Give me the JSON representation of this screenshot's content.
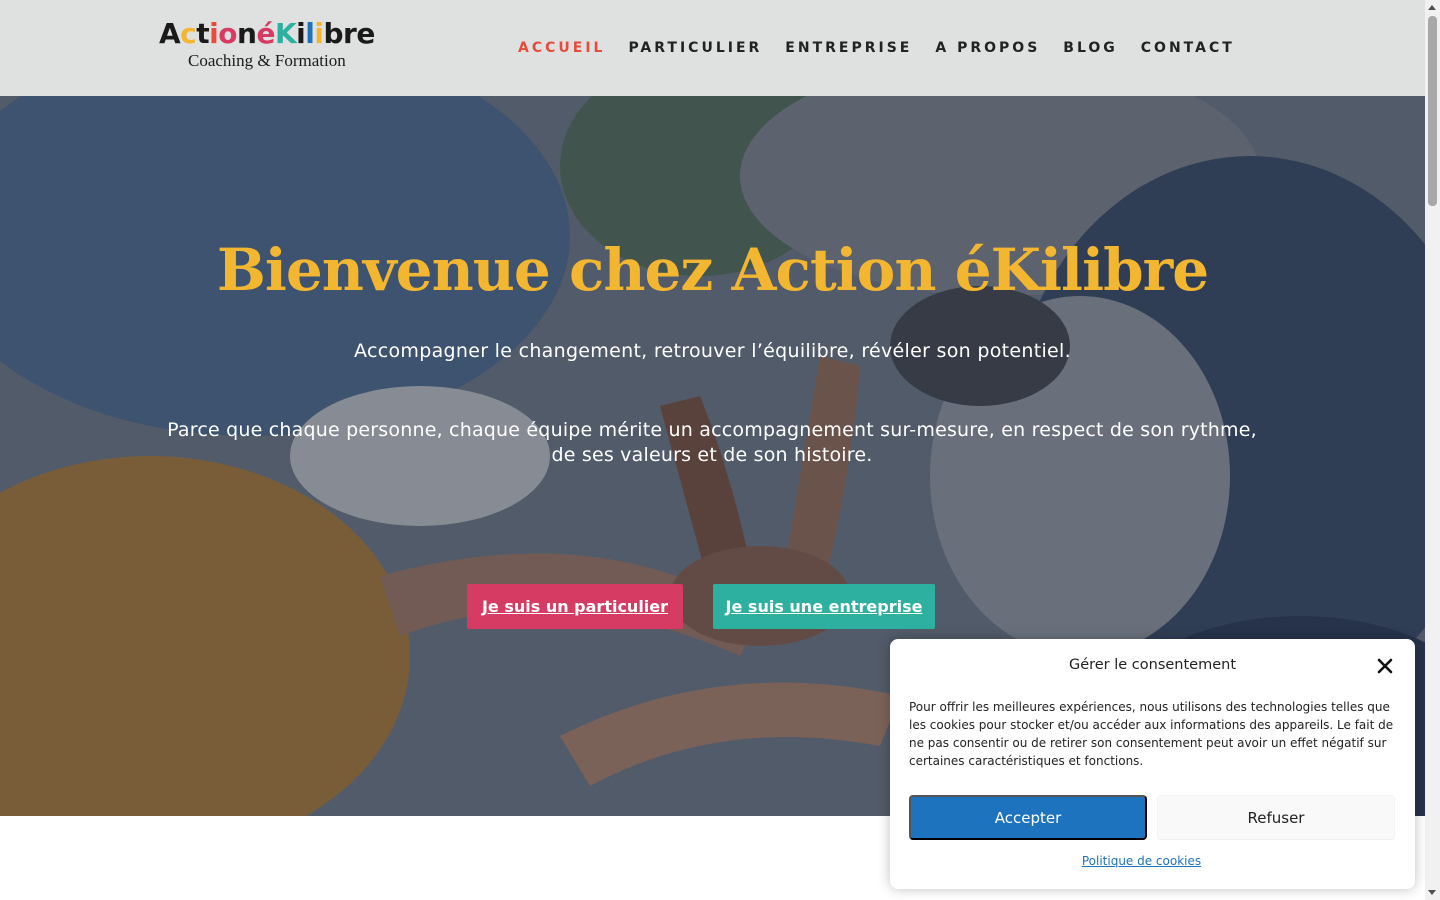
{
  "logo": {
    "letters": [
      {
        "ch": "A",
        "color": "#1a1a1a"
      },
      {
        "ch": "c",
        "color": "#f2b630"
      },
      {
        "ch": "t",
        "color": "#1a1a1a"
      },
      {
        "ch": "i",
        "color": "#e84b3c"
      },
      {
        "ch": "o",
        "color": "#d63b63"
      },
      {
        "ch": "n",
        "color": "#1a1a1a"
      },
      {
        "ch": "é",
        "color": "#d63b63"
      },
      {
        "ch": "K",
        "color": "#2eb0a0"
      },
      {
        "ch": "i",
        "color": "#1a1a1a"
      },
      {
        "ch": "l",
        "color": "#1e73be"
      },
      {
        "ch": "i",
        "color": "#f2b630"
      },
      {
        "ch": "b",
        "color": "#1a1a1a"
      },
      {
        "ch": "r",
        "color": "#1a1a1a"
      },
      {
        "ch": "e",
        "color": "#1a1a1a"
      }
    ],
    "tagline": "Coaching & Formation"
  },
  "nav": {
    "items": [
      {
        "label": "ACCUEIL",
        "active": true
      },
      {
        "label": "PARTICULIER",
        "active": false
      },
      {
        "label": "ENTREPRISE",
        "active": false
      },
      {
        "label": "A PROPOS",
        "active": false
      },
      {
        "label": "BLOG",
        "active": false
      },
      {
        "label": "CONTACT",
        "active": false
      }
    ],
    "active_color": "#e84b3c",
    "color": "#222222"
  },
  "hero": {
    "title": "Bienvenue chez Action éKilibre",
    "subtitle": "Accompagner le changement, retrouver l’équilibre, révéler son potentiel.",
    "paragraph": "Parce que chaque personne, chaque équipe mérite un accompagnement sur-mesure, en respect de son rythme, de ses valeurs et de son histoire.",
    "btn_particulier": "Je suis un particulier",
    "btn_entreprise": "Je suis une entreprise",
    "title_color": "#f2b630"
  },
  "consent": {
    "title": "Gérer le consentement",
    "text": "Pour offrir les meilleures expériences, nous utilisons des technologies telles que les cookies pour stocker et/ou accéder aux informations des appareils. Le fait de ne pas consentir ou de retirer son consentement peut avoir un effet négatif sur certaines caractéristiques et fonctions.",
    "accept": "Accepter",
    "refuse": "Refuser",
    "policy_link": "Politique de cookies",
    "close_icon": "close-icon"
  }
}
